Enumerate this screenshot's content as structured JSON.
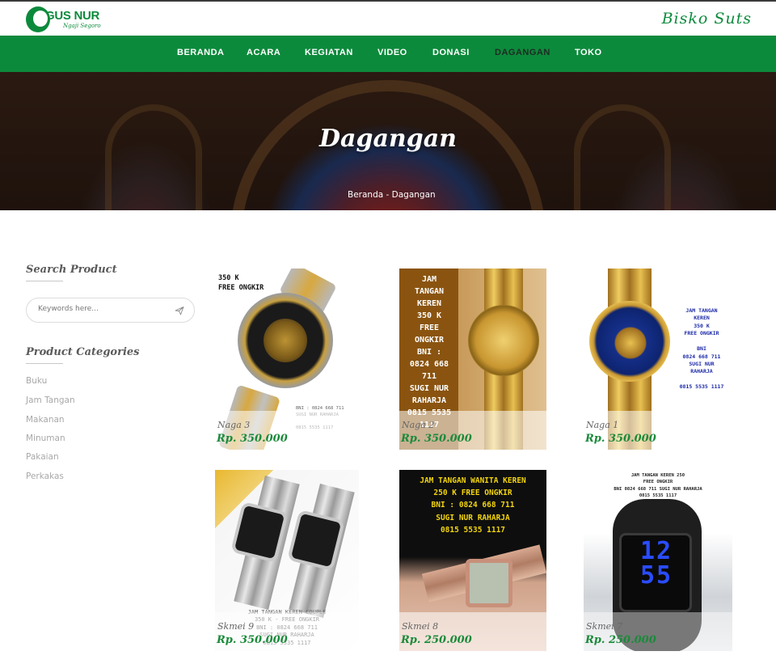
{
  "header": {
    "logo_title": "GUS NUR",
    "logo_tagline": "Ngaji Segoro",
    "signature": "Bisko Suts"
  },
  "nav": {
    "items": [
      "BERANDA",
      "ACARA",
      "KEGIATAN",
      "VIDEO",
      "DONASI",
      "DAGANGAN",
      "TOKO"
    ],
    "active": "DAGANGAN"
  },
  "hero": {
    "title": "Dagangan",
    "breadcrumb": "Beranda - Dagangan"
  },
  "sidebar": {
    "search_heading": "Search Product",
    "search_placeholder": "Keywords here...",
    "categories_heading": "Product Categories",
    "categories": [
      "Buku",
      "Jam Tangan",
      "Makanan",
      "Minuman",
      "Pakaian",
      "Perkakas"
    ]
  },
  "products": [
    {
      "name": "Naga 3",
      "price": "Rp. 350.000",
      "image_text": "350 K\nFREE ONGKIR",
      "image_footer": "BNI : 0824 668 711\nSUGI NUR RAHARJA\n\n0815 5535 1117"
    },
    {
      "name": "Naga 2",
      "price": "Rp. 350.000",
      "image_text": "JAM\nTANGAN\nKEREN\n350 K\nFREE\nONGKIR\nBNI :\n0824 668\n711\nSUGI NUR\nRAHARJA\n0815 5535\n1117"
    },
    {
      "name": "Naga 1",
      "price": "Rp. 350.000",
      "image_text": "JAM TANGAN\nKEREN\n350 K\nFREE ONGKIR\n\nBNI\n0824 668 711\nSUGI NUR\nRAHARJA\n\n0815 5535 1117"
    },
    {
      "name": "Skmei 9",
      "price": "Rp. 350.000",
      "image_text": "JAM TANGAN KEREN COUPLE\n350 K - FREE ONGKIR\nBNI : 0824 668 711\nSUGI NUR RAHARJA\n0815 5535 1117"
    },
    {
      "name": "Skmei 8",
      "price": "Rp. 250.000",
      "image_text": "JAM TANGAN WANITA KEREN\n250 K FREE ONGKIR\nBNI : 0824 668 711\nSUGI NUR RAHARJA\n0815 5535 1117"
    },
    {
      "name": "Skmei 7",
      "price": "Rp. 250.000",
      "image_text": "JAM TANGAN KEREN 250\nFREE ONGKIR\nBNI 0824 668 711 SUGI NUR RAHARJA\n0815 5535 1117",
      "display_digits": "1255"
    }
  ],
  "colors": {
    "brand_green": "#0c8a3c",
    "price_green": "#1a8a3a",
    "nav_active": "#1e2b22"
  }
}
